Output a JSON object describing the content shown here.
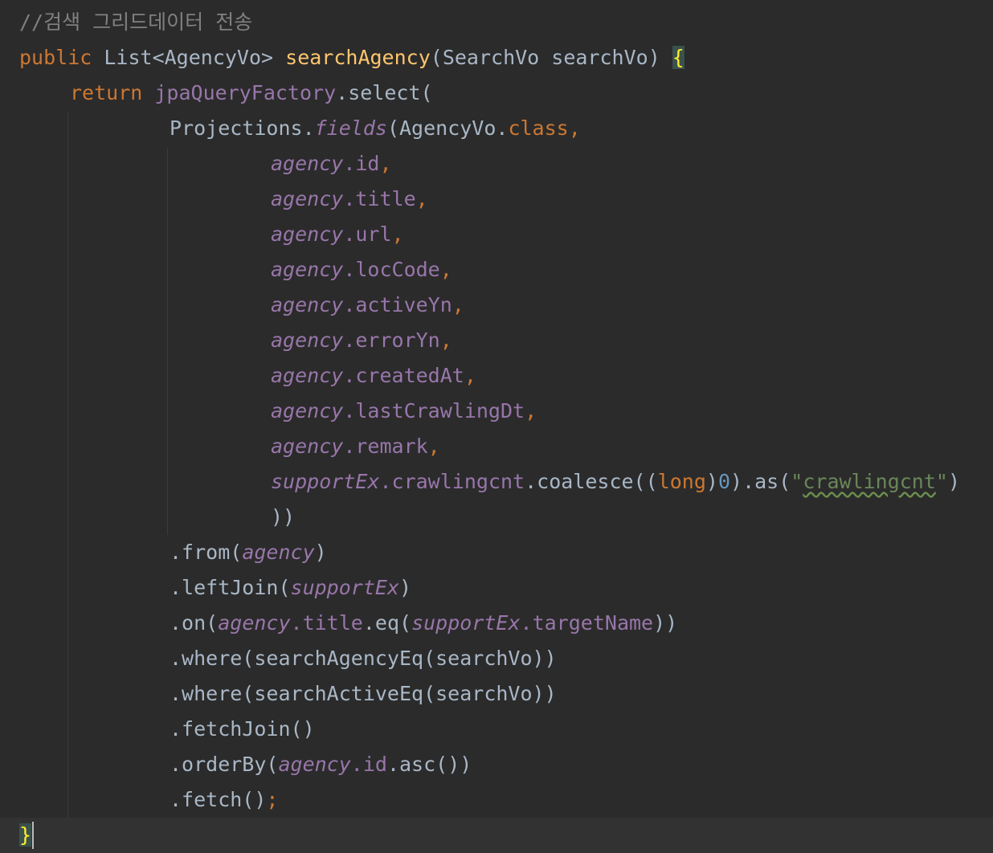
{
  "editor": {
    "lines": [
      [
        {
          "text": "//검색 그리드데이터 전송",
          "cls": "cm"
        }
      ],
      [
        {
          "text": "public ",
          "cls": "kw"
        },
        {
          "text": "List<AgencyVo> ",
          "cls": "id"
        },
        {
          "text": "searchAgency",
          "cls": "fn"
        },
        {
          "text": "(SearchVo searchVo) ",
          "cls": "id"
        },
        {
          "text": "{",
          "cls": "brace",
          "name": "open-brace-highlight"
        }
      ],
      [
        {
          "text": "return ",
          "cls": "kw"
        },
        {
          "text": "jpaQueryFactory",
          "cls": "field"
        },
        {
          "text": ".select(",
          "cls": "id"
        }
      ],
      [
        {
          "text": "Projections.",
          "cls": "id"
        },
        {
          "text": "fields",
          "cls": "it"
        },
        {
          "text": "(AgencyVo.",
          "cls": "id"
        },
        {
          "text": "class,",
          "cls": "kw"
        }
      ],
      [
        {
          "text": "agency",
          "cls": "it"
        },
        {
          "text": ".id",
          "cls": "field"
        },
        {
          "text": ",",
          "cls": "kw"
        }
      ],
      [
        {
          "text": "agency",
          "cls": "it"
        },
        {
          "text": ".title",
          "cls": "field"
        },
        {
          "text": ",",
          "cls": "kw"
        }
      ],
      [
        {
          "text": "agency",
          "cls": "it"
        },
        {
          "text": ".url",
          "cls": "field"
        },
        {
          "text": ",",
          "cls": "kw"
        }
      ],
      [
        {
          "text": "agency",
          "cls": "it"
        },
        {
          "text": ".locCode",
          "cls": "field"
        },
        {
          "text": ",",
          "cls": "kw"
        }
      ],
      [
        {
          "text": "agency",
          "cls": "it"
        },
        {
          "text": ".activeYn",
          "cls": "field"
        },
        {
          "text": ",",
          "cls": "kw"
        }
      ],
      [
        {
          "text": "agency",
          "cls": "it"
        },
        {
          "text": ".errorYn",
          "cls": "field"
        },
        {
          "text": ",",
          "cls": "kw"
        }
      ],
      [
        {
          "text": "agency",
          "cls": "it"
        },
        {
          "text": ".createdAt",
          "cls": "field"
        },
        {
          "text": ",",
          "cls": "kw"
        }
      ],
      [
        {
          "text": "agency",
          "cls": "it"
        },
        {
          "text": ".lastCrawlingDt",
          "cls": "field"
        },
        {
          "text": ",",
          "cls": "kw"
        }
      ],
      [
        {
          "text": "agency",
          "cls": "it"
        },
        {
          "text": ".remark",
          "cls": "field"
        },
        {
          "text": ",",
          "cls": "kw"
        }
      ],
      [
        {
          "text": "supportEx",
          "cls": "it"
        },
        {
          "text": ".crawlingcnt",
          "cls": "field"
        },
        {
          "text": ".coalesce((",
          "cls": "id"
        },
        {
          "text": "long",
          "cls": "kw"
        },
        {
          "text": ")",
          "cls": "id"
        },
        {
          "text": "0",
          "cls": "num"
        },
        {
          "text": ").as(",
          "cls": "id"
        },
        {
          "text": "\"",
          "cls": "st"
        },
        {
          "text": "crawlingcnt",
          "cls": "st typo",
          "name": "typo-string"
        },
        {
          "text": "\"",
          "cls": "st"
        },
        {
          "text": ")",
          "cls": "id"
        }
      ],
      [
        {
          "text": "))",
          "cls": "id"
        }
      ],
      [
        {
          "text": ".from(",
          "cls": "id"
        },
        {
          "text": "agency",
          "cls": "it"
        },
        {
          "text": ")",
          "cls": "id"
        }
      ],
      [
        {
          "text": ".leftJoin(",
          "cls": "id"
        },
        {
          "text": "supportEx",
          "cls": "it"
        },
        {
          "text": ")",
          "cls": "id"
        }
      ],
      [
        {
          "text": ".on(",
          "cls": "id"
        },
        {
          "text": "agency",
          "cls": "it"
        },
        {
          "text": ".title",
          "cls": "field"
        },
        {
          "text": ".eq(",
          "cls": "id"
        },
        {
          "text": "supportEx",
          "cls": "it"
        },
        {
          "text": ".targetName",
          "cls": "field"
        },
        {
          "text": "))",
          "cls": "id"
        }
      ],
      [
        {
          "text": ".where(searchAgencyEq(searchVo))",
          "cls": "id"
        }
      ],
      [
        {
          "text": ".where(searchActiveEq(searchVo))",
          "cls": "id"
        }
      ],
      [
        {
          "text": ".fetchJoin()",
          "cls": "id"
        }
      ],
      [
        {
          "text": ".orderBy(",
          "cls": "id"
        },
        {
          "text": "agency",
          "cls": "it"
        },
        {
          "text": ".id",
          "cls": "field"
        },
        {
          "text": ".asc())",
          "cls": "id"
        }
      ],
      [
        {
          "text": ".fetch()",
          "cls": "id"
        },
        {
          "text": ";",
          "cls": "kw"
        }
      ],
      [
        {
          "text": "}",
          "cls": "brace",
          "name": "close-brace-highlight"
        }
      ]
    ]
  }
}
